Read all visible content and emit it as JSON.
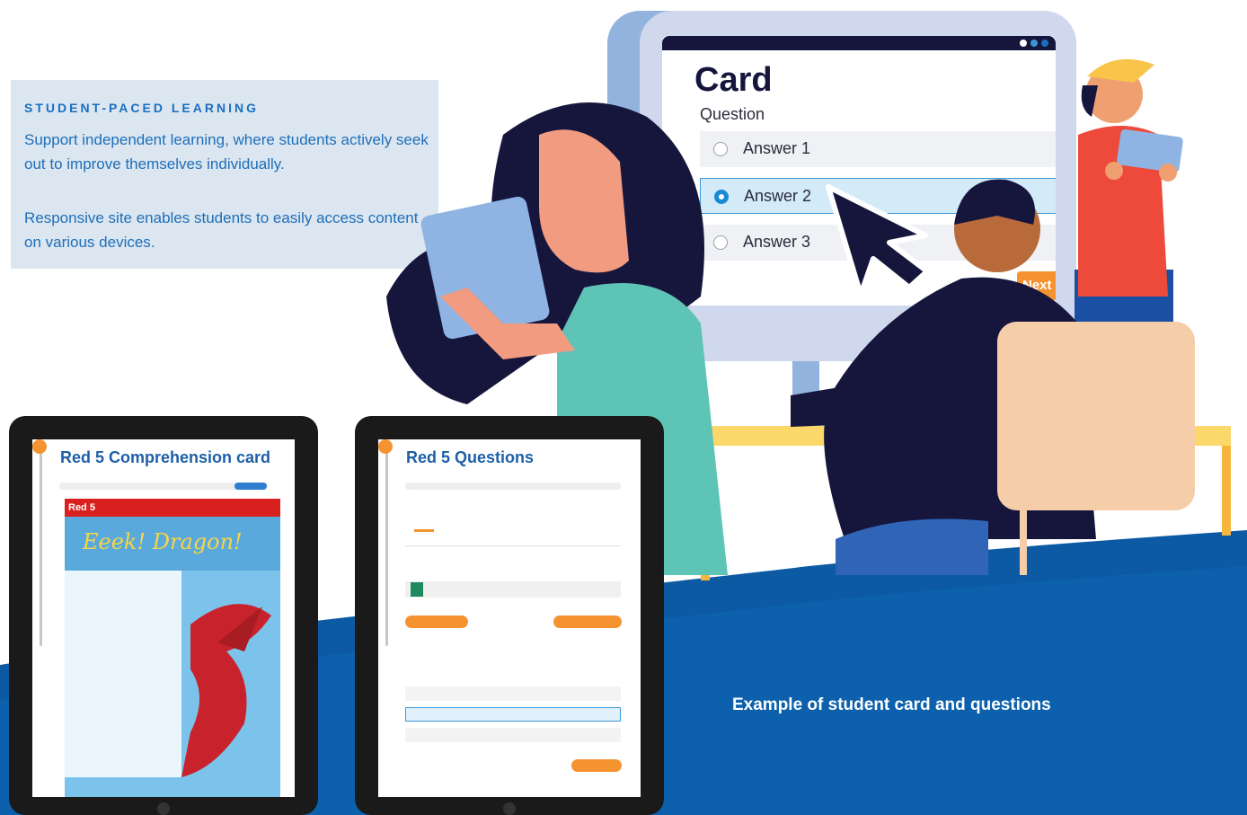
{
  "info": {
    "eyebrow": "STUDENT-PACED LEARNING",
    "paragraph1": "Support independent learning, where students actively seek out to improve themselves individually.",
    "paragraph2": "Responsive site enables students to easily access content on various devices."
  },
  "card": {
    "title": "Card",
    "question": "Question",
    "answers": [
      "Answer 1",
      "Answer 2",
      "Answer 3"
    ],
    "selected_answer": "Answer 2",
    "next_label": "Next"
  },
  "tablet_left": {
    "title": "Red 5 Comprehension card",
    "band_label": "Red 5",
    "story_title": "Eeek! Dragon!"
  },
  "tablet_right": {
    "title": "Red 5 Questions"
  },
  "caption": "Example of student card and questions",
  "colors": {
    "brand_blue": "#0b5aa3",
    "accent_orange": "#f59331",
    "dark_navy": "#16163d",
    "panel_bg": "#dbe6f1"
  }
}
